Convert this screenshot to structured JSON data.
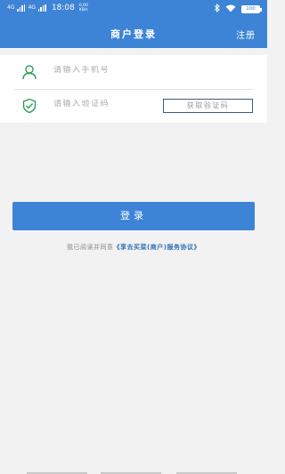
{
  "status_bar": {
    "signal1": "4G",
    "signal2": "4G",
    "time": "18:08",
    "speed_value": "0.00",
    "speed_unit": "KB/s",
    "battery": "100"
  },
  "header": {
    "title": "商户登录",
    "register_label": "注册"
  },
  "form": {
    "phone_placeholder": "请输入手机号",
    "code_placeholder": "请输入验证码",
    "get_code_label": "获取验证码"
  },
  "login_label": "登录",
  "agreement": {
    "prefix": "我已阅读并同意",
    "link": "《享去买菜(商户)服务协议》"
  },
  "colors": {
    "primary": "#3d84d6",
    "background": "#f2f2f2",
    "icon_green": "#2e9e58"
  },
  "icons": {
    "phone_row": "user-icon",
    "code_row": "shield-check-icon"
  }
}
